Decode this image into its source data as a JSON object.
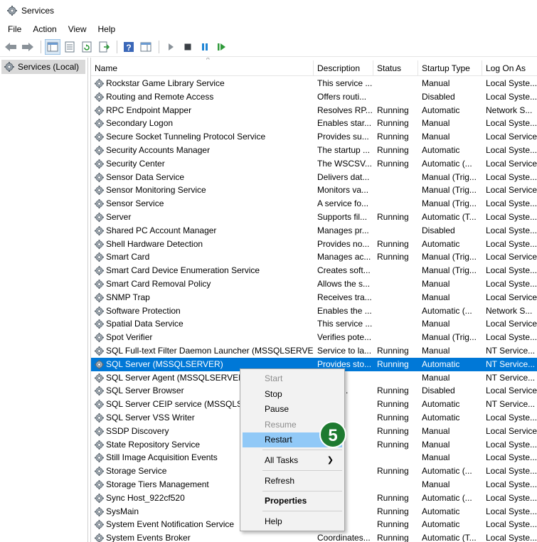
{
  "window": {
    "title": "Services"
  },
  "menubar": {
    "items": [
      "File",
      "Action",
      "View",
      "Help"
    ]
  },
  "toolbar": {
    "icons": [
      "back-arrow-icon",
      "forward-arrow-icon",
      "show-tree-icon",
      "properties-icon",
      "refresh-icon",
      "export-list-icon",
      "help-icon",
      "action-pane-icon",
      "start-service-icon",
      "stop-service-icon",
      "pause-service-icon",
      "restart-service-icon"
    ]
  },
  "tree": {
    "root_label": "Services (Local)"
  },
  "columns": {
    "name": "Name",
    "description": "Description",
    "status": "Status",
    "startup_type": "Startup Type",
    "log_on_as": "Log On As"
  },
  "rows": [
    {
      "name": "Rockstar Game Library Service",
      "desc": "This service ...",
      "status": "",
      "startup": "Manual",
      "logon": "Local Syste..."
    },
    {
      "name": "Routing and Remote Access",
      "desc": "Offers routi...",
      "status": "",
      "startup": "Disabled",
      "logon": "Local Syste..."
    },
    {
      "name": "RPC Endpoint Mapper",
      "desc": "Resolves RP...",
      "status": "Running",
      "startup": "Automatic",
      "logon": "Network S..."
    },
    {
      "name": "Secondary Logon",
      "desc": "Enables star...",
      "status": "Running",
      "startup": "Manual",
      "logon": "Local Syste..."
    },
    {
      "name": "Secure Socket Tunneling Protocol Service",
      "desc": "Provides su...",
      "status": "Running",
      "startup": "Manual",
      "logon": "Local Service"
    },
    {
      "name": "Security Accounts Manager",
      "desc": "The startup ...",
      "status": "Running",
      "startup": "Automatic",
      "logon": "Local Syste..."
    },
    {
      "name": "Security Center",
      "desc": "The WSCSV...",
      "status": "Running",
      "startup": "Automatic (...",
      "logon": "Local Service"
    },
    {
      "name": "Sensor Data Service",
      "desc": "Delivers dat...",
      "status": "",
      "startup": "Manual (Trig...",
      "logon": "Local Syste..."
    },
    {
      "name": "Sensor Monitoring Service",
      "desc": "Monitors va...",
      "status": "",
      "startup": "Manual (Trig...",
      "logon": "Local Service"
    },
    {
      "name": "Sensor Service",
      "desc": "A service fo...",
      "status": "",
      "startup": "Manual (Trig...",
      "logon": "Local Syste..."
    },
    {
      "name": "Server",
      "desc": "Supports fil...",
      "status": "Running",
      "startup": "Automatic (T...",
      "logon": "Local Syste..."
    },
    {
      "name": "Shared PC Account Manager",
      "desc": "Manages pr...",
      "status": "",
      "startup": "Disabled",
      "logon": "Local Syste..."
    },
    {
      "name": "Shell Hardware Detection",
      "desc": "Provides no...",
      "status": "Running",
      "startup": "Automatic",
      "logon": "Local Syste..."
    },
    {
      "name": "Smart Card",
      "desc": "Manages ac...",
      "status": "Running",
      "startup": "Manual (Trig...",
      "logon": "Local Service"
    },
    {
      "name": "Smart Card Device Enumeration Service",
      "desc": "Creates soft...",
      "status": "",
      "startup": "Manual (Trig...",
      "logon": "Local Syste..."
    },
    {
      "name": "Smart Card Removal Policy",
      "desc": "Allows the s...",
      "status": "",
      "startup": "Manual",
      "logon": "Local Syste..."
    },
    {
      "name": "SNMP Trap",
      "desc": "Receives tra...",
      "status": "",
      "startup": "Manual",
      "logon": "Local Service"
    },
    {
      "name": "Software Protection",
      "desc": "Enables the ...",
      "status": "",
      "startup": "Automatic (...",
      "logon": "Network S..."
    },
    {
      "name": "Spatial Data Service",
      "desc": "This service ...",
      "status": "",
      "startup": "Manual",
      "logon": "Local Service"
    },
    {
      "name": "Spot Verifier",
      "desc": "Verifies pote...",
      "status": "",
      "startup": "Manual (Trig...",
      "logon": "Local Syste..."
    },
    {
      "name": "SQL Full-text Filter Daemon Launcher (MSSQLSERVER)",
      "desc": "Service to la...",
      "status": "Running",
      "startup": "Manual",
      "logon": "NT Service..."
    },
    {
      "name": "SQL Server (MSSQLSERVER)",
      "desc": "Provides sto...",
      "status": "Running",
      "startup": "Automatic",
      "logon": "NT Service...",
      "selected": true
    },
    {
      "name": "SQL Server Agent (MSSQLSERVER)",
      "desc": "es jo...",
      "status": "",
      "startup": "Manual",
      "logon": "NT Service..."
    },
    {
      "name": "SQL Server Browser",
      "desc": "es SQ...",
      "status": "Running",
      "startup": "Disabled",
      "logon": "Local Service"
    },
    {
      "name": "SQL Server CEIP service (MSSQLSERV",
      "desc": "ce th...",
      "status": "Running",
      "startup": "Automatic",
      "logon": "NT Service..."
    },
    {
      "name": "SQL Server VSS Writer",
      "desc": "es th...",
      "status": "Running",
      "startup": "Automatic",
      "logon": "Local Syste..."
    },
    {
      "name": "SSDP Discovery",
      "desc": "s n...",
      "status": "Running",
      "startup": "Manual",
      "logon": "Local Service"
    },
    {
      "name": "State Repository Service",
      "desc": "es re...",
      "status": "Running",
      "startup": "Manual",
      "logon": "Local Syste..."
    },
    {
      "name": "Still Image Acquisition Events",
      "desc": "es a...",
      "status": "",
      "startup": "Manual",
      "logon": "Local Syste..."
    },
    {
      "name": "Storage Service",
      "desc": "es en...",
      "status": "Running",
      "startup": "Automatic (...",
      "logon": "Local Syste..."
    },
    {
      "name": "Storage Tiers Management",
      "desc": "es ...",
      "status": "",
      "startup": "Manual",
      "logon": "Local Syste..."
    },
    {
      "name": "Sync Host_922cf520",
      "desc": "vice ...",
      "status": "Running",
      "startup": "Automatic (...",
      "logon": "Local Syste..."
    },
    {
      "name": "SysMain",
      "desc": "ns a...",
      "status": "Running",
      "startup": "Automatic",
      "logon": "Local Syste..."
    },
    {
      "name": "System Event Notification Service",
      "desc": "rs sy...",
      "status": "Running",
      "startup": "Automatic",
      "logon": "Local Syste..."
    },
    {
      "name": "System Events Broker",
      "desc": "Coordinates...",
      "status": "Running",
      "startup": "Automatic (T...",
      "logon": "Local Syste..."
    }
  ],
  "context_menu": {
    "start": "Start",
    "stop": "Stop",
    "pause": "Pause",
    "resume": "Resume",
    "restart": "Restart",
    "all_tasks": "All Tasks",
    "refresh": "Refresh",
    "properties": "Properties",
    "help": "Help"
  },
  "annotation": {
    "step_number": "5",
    "color": "#1e7a30"
  },
  "colors": {
    "selection": "#0078d7",
    "menu_highlight": "#91c9f7"
  }
}
